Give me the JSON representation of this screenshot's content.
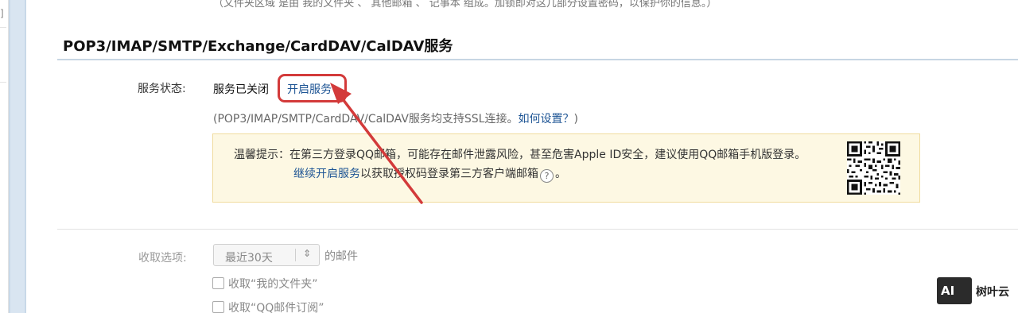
{
  "top_note": "（文件夹区域 是由 我的文件夹 、 其他邮箱 、 记事本 组成。加锁即对这几部分设置密码，以保护你的信息。）",
  "section": {
    "title": "POP3/IMAP/SMTP/Exchange/CardDAV/CalDAV服务"
  },
  "service_status": {
    "label": "服务状态:",
    "value": "服务已关闭",
    "open_link": "开启服务"
  },
  "ssl_note": {
    "prefix": "(POP3/IMAP/SMTP/CardDAV/CalDAV服务均支持SSL连接。",
    "link": "如何设置？",
    "suffix": ")"
  },
  "tip": {
    "line1": "温馨提示：在第三方登录QQ邮箱，可能存在邮件泄露风险，甚至危害Apple ID安全，建议使用QQ邮箱手机版登录。",
    "line2_link": "继续开启服务",
    "line2_text": "以获取授权码登录第三方客户端邮箱",
    "help_icon": "question-mark-icon",
    "help_glyph": "?",
    "line2_end": "。"
  },
  "fetch_options": {
    "label": "收取选项:",
    "select_value": "最近30天",
    "select_arrow": "⇕",
    "suffix": "的邮件",
    "checkboxes": [
      {
        "label": "收取“我的文件夹”",
        "checked": false
      },
      {
        "label": "收取“QQ邮件订阅”",
        "checked": false
      }
    ]
  },
  "watermark": {
    "logo": "AI",
    "text": "树叶云"
  },
  "left_edge": {
    "bracket": "]"
  },
  "colors": {
    "link": "#1d5494",
    "highlight": "#d33a3a",
    "tip_bg": "#fdf8e3",
    "tip_border": "#f0dc9e",
    "section_line": "#c7d6e3"
  }
}
